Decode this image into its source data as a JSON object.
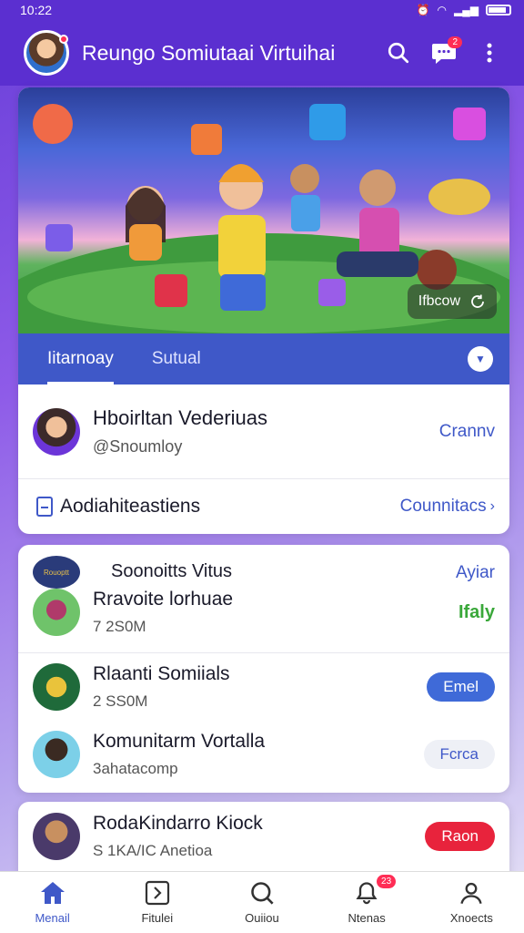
{
  "status": {
    "time": "10:22"
  },
  "app": {
    "title": "Reungo Somiutaai Virtuihai",
    "message_badge": "2"
  },
  "hero": {
    "badge": "Ifbcow"
  },
  "tabs": [
    {
      "label": "Iitarnoay",
      "active": true
    },
    {
      "label": "Sutual",
      "active": false
    }
  ],
  "profile": {
    "name": "Hboirltan Vederiuas",
    "handle": "@Snoumloy",
    "action": "Crannv"
  },
  "notifications": {
    "label": "Aodiahiteastiens",
    "action": "Counnitacs"
  },
  "games": {
    "header": "Soonoitts Vitus",
    "header_link": "Ayiar",
    "header_logo": "Rouoptt",
    "items": [
      {
        "title": "Rravoite lorhuae",
        "sub": "7 2S0M",
        "action": "Ifaly"
      },
      {
        "title": "Rlaanti Somiials",
        "sub": "2 SS0M",
        "action": "Emel"
      },
      {
        "title": "Komunitarm Vortalla",
        "sub": "3ahatacomp",
        "action": "Fcrca"
      }
    ]
  },
  "featured": {
    "title": "RodaKindarro Kiock",
    "sub": "S 1KA/IC Anetioa",
    "action": "Raon"
  },
  "nav": [
    {
      "label": "Menail",
      "icon": "home-icon",
      "badge": ""
    },
    {
      "label": "Fitulei",
      "icon": "play-icon",
      "badge": ""
    },
    {
      "label": "Ouiiou",
      "icon": "search-icon",
      "badge": ""
    },
    {
      "label": "Ntenas",
      "icon": "bell-icon",
      "badge": "23"
    },
    {
      "label": "Xnoects",
      "icon": "profile-icon",
      "badge": ""
    }
  ],
  "colors": {
    "primary": "#5b2fd0",
    "accent": "#3f58c8",
    "danger": "#e8233c"
  }
}
